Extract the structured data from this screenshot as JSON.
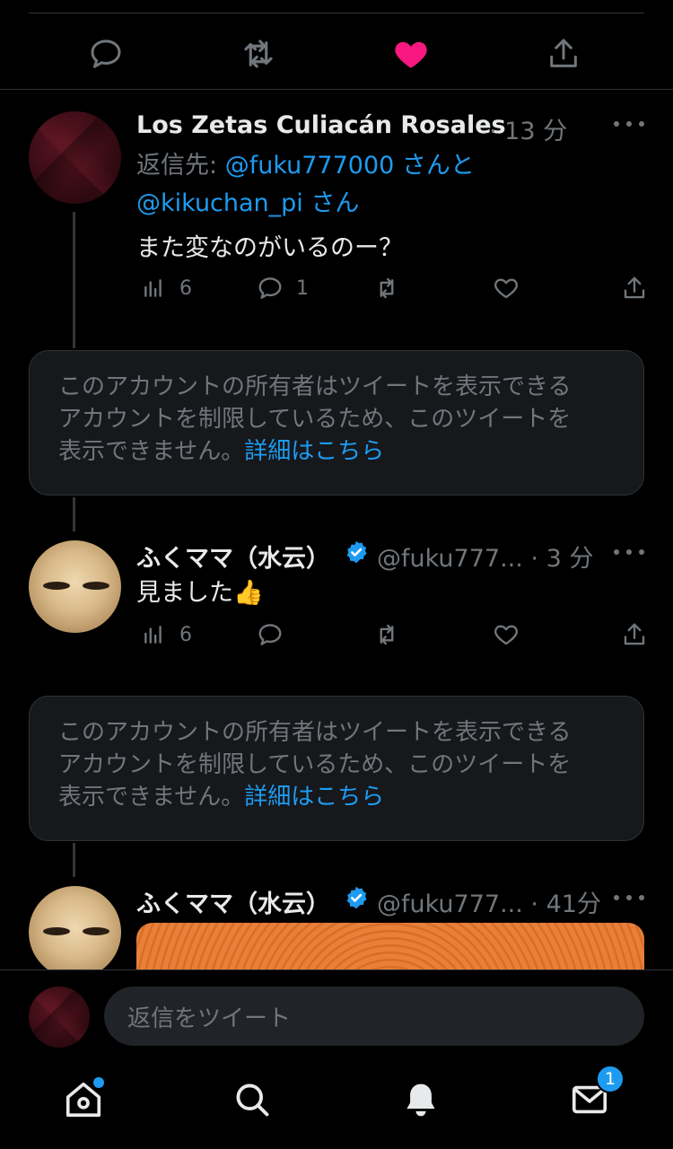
{
  "colors": {
    "background": "#000000",
    "text": "#e7e9ea",
    "muted": "#71767b",
    "link": "#1d9bf0",
    "like": "#f91880",
    "card": "#16181c",
    "divider": "#2f3336"
  },
  "top_actions": {
    "reply_icon": "reply-icon",
    "retweet_icon": "retweet-icon",
    "like_icon": "heart-filled-icon",
    "share_icon": "share-icon",
    "liked": true
  },
  "tweets": [
    {
      "author": "Los Zetas Culiacán Rosales",
      "meta": "· 13 分",
      "reply_prefix": "返信先:",
      "reply_user1": "@fuku777000",
      "reply_mid": "さんと",
      "reply_user2": "@kikuchan_pi",
      "reply_suffix": "さん",
      "text": "また変なのがいるのー？",
      "views": "6",
      "replies": "1"
    },
    {
      "author": "ふくママ（水云）",
      "meta": "@fuku777... · 3 分",
      "text": "見ました👍",
      "views": "6"
    },
    {
      "author": "ふくママ（水云）",
      "meta": "@fuku777... · 41分"
    }
  ],
  "restricted_notice": {
    "text": "このアカウントの所有者はツイートを表示できるアカウントを制限しているため、このツイートを表示できません。",
    "line1": "このアカウントの所有者はツイートを表示できる",
    "line2": "アカウントを制限しているため、このツイートを",
    "line3": "表示できません。",
    "link": "詳細はこちら"
  },
  "compose": {
    "placeholder": "返信をツイート"
  },
  "tabs": {
    "home_icon": "home-icon",
    "search_icon": "search-icon",
    "notifications_icon": "bell-icon",
    "messages_icon": "mail-icon",
    "messages_badge": "1"
  }
}
